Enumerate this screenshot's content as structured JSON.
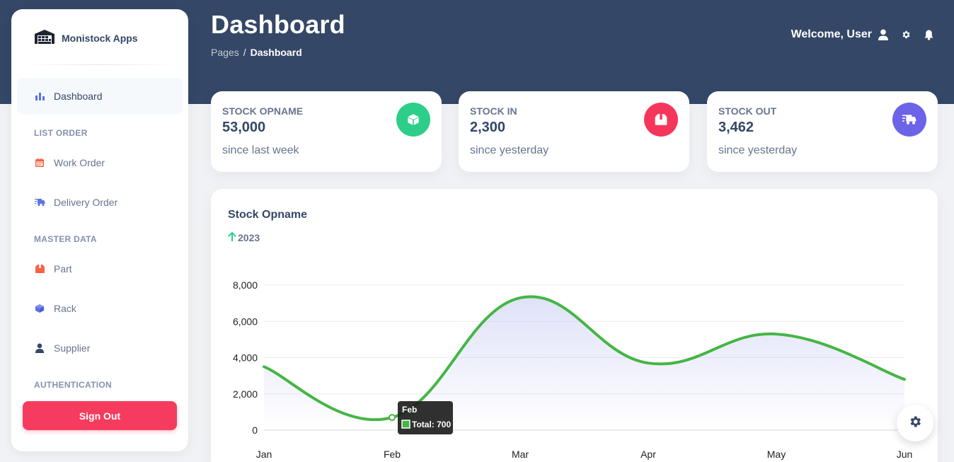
{
  "app": {
    "name": "Monistock Apps"
  },
  "header": {
    "title": "Dashboard",
    "breadcrumb": {
      "parent": "Pages",
      "separator": "/",
      "current": "Dashboard"
    },
    "welcome": "Welcome, User"
  },
  "sidebar": {
    "items": [
      {
        "label": "Dashboard",
        "icon": "bar-chart-icon",
        "active": true
      },
      {
        "label": "Work Order",
        "icon": "calendar-icon"
      },
      {
        "label": "Delivery Order",
        "icon": "truck-icon"
      },
      {
        "label": "Part",
        "icon": "box-open-icon"
      },
      {
        "label": "Rack",
        "icon": "cube-icon"
      },
      {
        "label": "Supplier",
        "icon": "user-icon"
      }
    ],
    "sections": {
      "list_order": "LIST ORDER",
      "master_data": "MASTER DATA",
      "authentication": "AUTHENTICATION"
    },
    "sign_out": "Sign Out"
  },
  "stats": [
    {
      "label": "STOCK OPNAME",
      "value": "53,000",
      "sub": "since last week",
      "color": "#2dce89",
      "icon": "cube-icon"
    },
    {
      "label": "STOCK IN",
      "value": "2,300",
      "sub": "since yesterday",
      "color": "#f5365c",
      "icon": "box-open-icon"
    },
    {
      "label": "STOCK OUT",
      "value": "3,462",
      "sub": "since yesterday",
      "color": "#5e72e4",
      "icon": "truck-icon"
    }
  ],
  "chart": {
    "title": "Stock Opname",
    "subtitle": "2023",
    "tooltip": {
      "title": "Feb",
      "label": "Total: 700"
    }
  },
  "chart_data": {
    "type": "line",
    "title": "Stock Opname",
    "subtitle": "2023",
    "categories": [
      "Jan",
      "Feb",
      "Mar",
      "Apr",
      "May",
      "Jun"
    ],
    "series": [
      {
        "values": [
          3500,
          700,
          7300,
          3700,
          5300,
          2800
        ],
        "color": "#45b545"
      }
    ],
    "y_ticks": [
      "0",
      "2,000",
      "4,000",
      "6,000",
      "8,000"
    ],
    "ylim": [
      0,
      8000
    ],
    "grid": true,
    "fill": "gradient"
  }
}
